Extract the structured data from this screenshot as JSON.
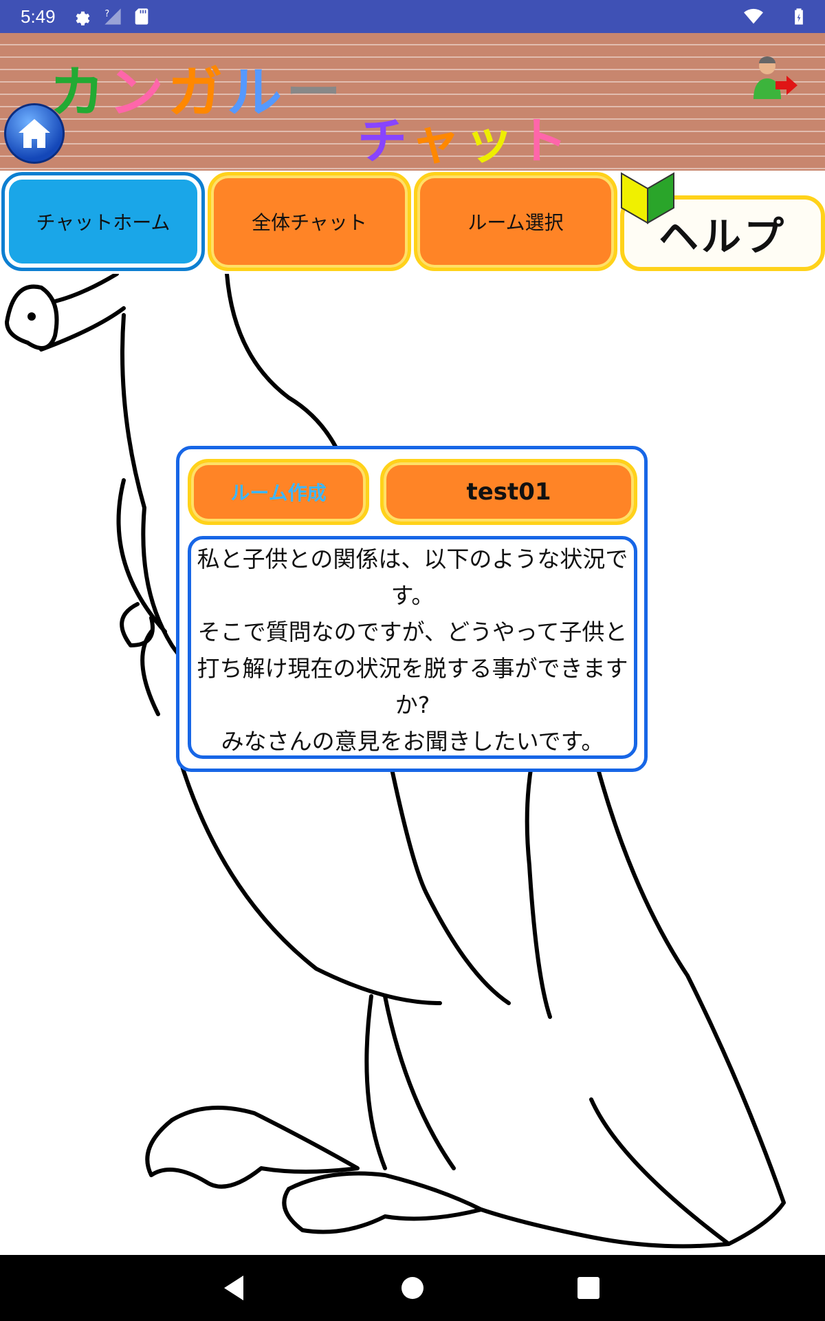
{
  "status_bar": {
    "time": "5:49",
    "icons": [
      "gear-icon",
      "no-signal-icon",
      "sd-card-icon",
      "wifi-icon",
      "battery-icon"
    ]
  },
  "banner": {
    "title_line1": [
      "カ",
      "ン",
      "ガ",
      "ル",
      "ー"
    ],
    "title_line2": [
      "チ",
      "ャ",
      "ッ",
      "ト"
    ],
    "home_icon": "home-icon",
    "logout_icon": "logout-icon"
  },
  "tabs": {
    "chat_home": "チャットホーム",
    "all_chat": "全体チャット",
    "room_select": "ルーム選択",
    "help": "ヘルプ"
  },
  "dialog": {
    "create_room": "ルーム作成",
    "room_name": "test01",
    "message": "私と子供との関係は、以下のような状況です。\nそこで質問なのですが、どうやって子供と打ち解け現在の状況を脱する事ができますか?\nみなさんの意見をお聞きしたいです。"
  },
  "nav_bar": {
    "icons": [
      "back-icon",
      "home-circle-icon",
      "recents-icon"
    ]
  },
  "colors": {
    "status_bar": "#3f51b5",
    "banner": "#c8866e",
    "tab_active": "#1aa6e8",
    "tab_orange": "#ff8426",
    "tab_border": "#ffd21a",
    "dialog_border": "#1766e6"
  }
}
